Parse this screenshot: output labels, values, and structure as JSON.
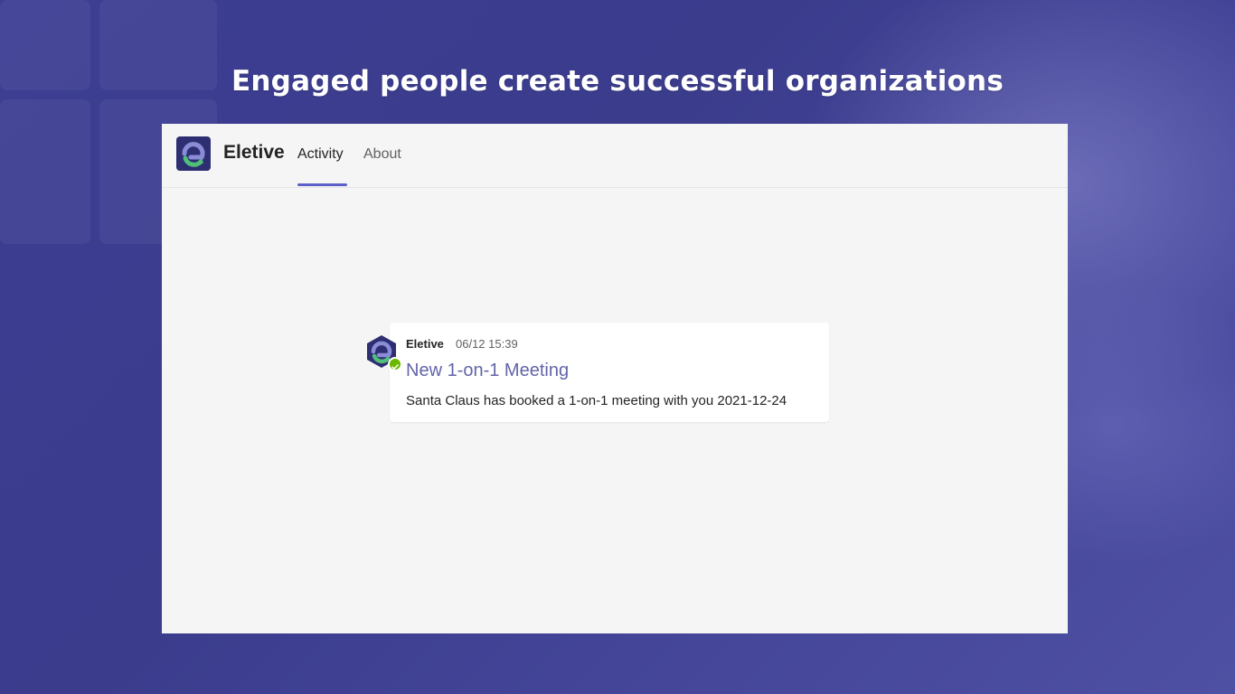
{
  "headline": "Engaged people create successful organizations",
  "app": {
    "name": "Eletive",
    "logo_icon": "eletive-logo-icon",
    "tabs": [
      {
        "label": "Activity",
        "active": true
      },
      {
        "label": "About",
        "active": false
      }
    ]
  },
  "notification": {
    "sender": "Eletive",
    "timestamp": "06/12 15:39",
    "title": "New 1-on-1 Meeting",
    "body": "Santa Claus has booked a 1-on-1 meeting with you 2021-12-24",
    "presence": "available",
    "presence_icon": "check-icon"
  },
  "colors": {
    "background": "#3a3b8e",
    "accent": "#5b5fc7",
    "link": "#6264a7",
    "presence": "#6bb700",
    "logo_green": "#4fbf7a"
  }
}
